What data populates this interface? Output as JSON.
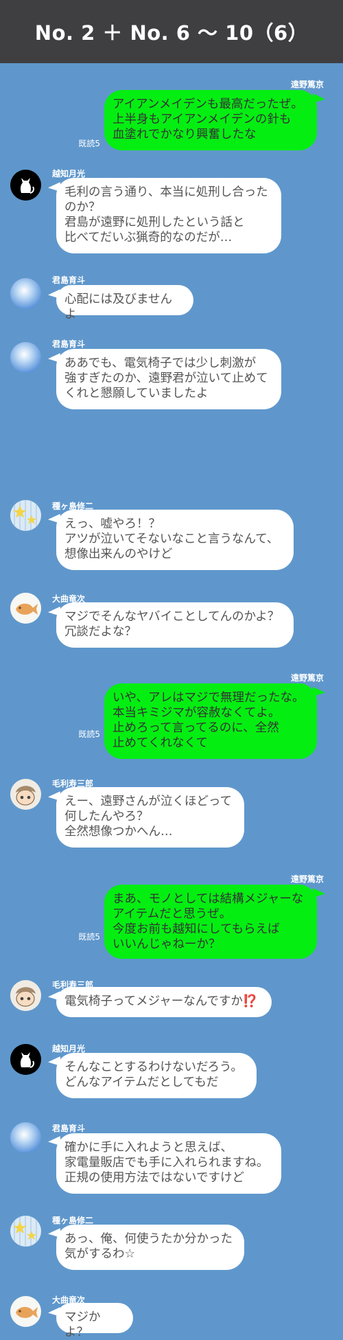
{
  "header": {
    "title": "No. 2 ＋ No. 6 〜 10（6）"
  },
  "messages": [
    {
      "side": "out",
      "sender": "遠野篤京",
      "read": "既読5",
      "text": "アイアンメイデンも最高だったぜ。\n上半身もアイアンメイデンの針も\n血塗れでかなり興奮したな"
    },
    {
      "side": "in",
      "sender": "越知月光",
      "avatar": "cat-avatar-icon",
      "text": "毛利の言う通り、本当に処刑し合った\nのか？\n君島が遠野に処刑したという話と\n比べてだいぶ猟奇的なのだが…"
    },
    {
      "side": "in",
      "sender": "君島育斗",
      "avatar": "sky-avatar-icon",
      "text": "心配には及びませんよ"
    },
    {
      "side": "in",
      "sender": "君島育斗",
      "avatar": "sky-avatar-icon",
      "text": "ああでも、電気椅子では少し刺激が\n強すぎたのか、遠野君が泣いて止めて\nくれと懇願していましたよ"
    },
    {
      "side": "in",
      "sender": "種ヶ島修二",
      "avatar": "stars-avatar-icon",
      "text": "えっ、嘘やろ！？\nアツが泣いてそないなこと言うなんて、\n想像出来んのやけど"
    },
    {
      "side": "in",
      "sender": "大曲竜次",
      "avatar": "taiyaki-avatar-icon",
      "text": "マジでそんなヤバイことしてんのかよ？\n冗談だよな？"
    },
    {
      "side": "out",
      "sender": "遠野篤京",
      "read": "既読5",
      "text": "いや、アレはマジで無理だったな。\n本当キミジマが容赦なくてよ。\n止めろって言ってるのに、全然\n止めてくれなくて"
    },
    {
      "side": "in",
      "sender": "毛利寿三郎",
      "avatar": "character-avatar-icon",
      "text": "えー、遠野さんが泣くほどって\n何したんやろ？\n全然想像つかへん…"
    },
    {
      "side": "out",
      "sender": "遠野篤京",
      "read": "既読5",
      "text": "まあ、モノとしては結構メジャーな\nアイテムだと思うぜ。\n今度お前も越知にしてもらえば\nいいんじゃねーか？"
    },
    {
      "side": "in",
      "sender": "毛利寿三郎",
      "avatar": "character-avatar-icon",
      "text": "電気椅子ってメジャーなんですか⁉️"
    },
    {
      "side": "in",
      "sender": "越知月光",
      "avatar": "cat-avatar-icon",
      "text": "そんなことするわけないだろう。\nどんなアイテムだとしてもだ"
    },
    {
      "side": "in",
      "sender": "君島育斗",
      "avatar": "sky-avatar-icon",
      "text": "確かに手に入れようと思えば、\n家電量販店でも手に入れられますね。\n正規の使用方法ではないですけど"
    },
    {
      "side": "in",
      "sender": "種ヶ島修二",
      "avatar": "stars-avatar-icon",
      "text": "あっ、俺、何使うたか分かった\n気がするわ☆"
    },
    {
      "side": "in",
      "sender": "大曲竜次",
      "avatar": "taiyaki-avatar-icon",
      "text": "マジかよ？"
    }
  ]
}
